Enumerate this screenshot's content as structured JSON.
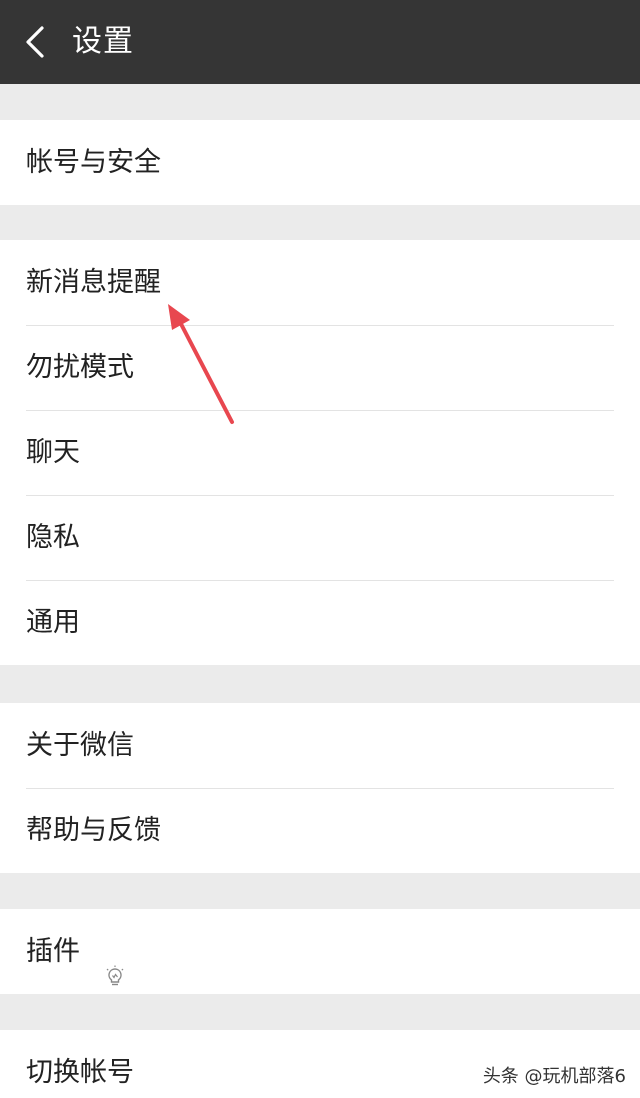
{
  "header": {
    "title": "设置",
    "back_icon": "back-chevron-icon"
  },
  "groups": [
    {
      "items": [
        {
          "label": "帐号与安全"
        }
      ]
    },
    {
      "items": [
        {
          "label": "新消息提醒"
        },
        {
          "label": "勿扰模式"
        },
        {
          "label": "聊天"
        },
        {
          "label": "隐私"
        },
        {
          "label": "通用"
        }
      ]
    },
    {
      "items": [
        {
          "label": "关于微信"
        },
        {
          "label": "帮助与反馈"
        }
      ]
    },
    {
      "items": [
        {
          "label": "插件",
          "icon": "lightbulb-icon"
        }
      ]
    },
    {
      "items": [
        {
          "label": "切换帐号"
        }
      ]
    }
  ],
  "annotation": {
    "arrow_color": "#e8474f",
    "points_to": "新消息提醒"
  },
  "watermark": "头条 @玩机部落6",
  "colors": {
    "topbar": "#353535",
    "background": "#ebebeb",
    "row": "#ffffff"
  }
}
